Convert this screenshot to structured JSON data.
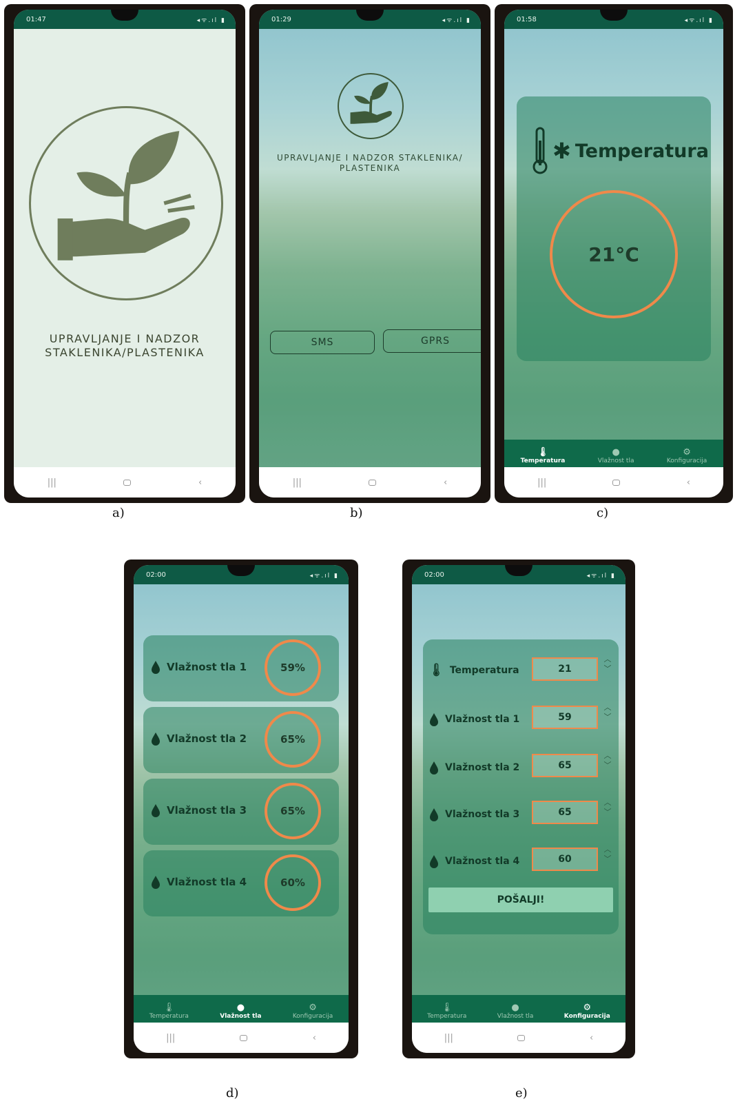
{
  "captions": [
    "a)",
    "b)",
    "c)",
    "d)",
    "e)"
  ],
  "status_times": {
    "a": "01:47",
    "b": "01:29",
    "c": "01:58",
    "d": "02:00",
    "e": "02:00"
  },
  "status_icons": "◂ᯤ.ıl ▮",
  "nav_buttons": {
    "recents": "|||",
    "back": "‹"
  },
  "app_title_a_line1": "UPRAVLJANJE I NADZOR",
  "app_title_a_line2": "STAKLENIKA/PLASTENIKA",
  "app_title_b_line1": "UPRAVLJANJE I NADZOR STAKLENIKA/",
  "app_title_b_line2": "PLASTENIKA",
  "connect_buttons": {
    "sms": "SMS",
    "gprs": "GPRS"
  },
  "temperature_screen": {
    "title": "Temperatura",
    "value": "21°C"
  },
  "moisture_screen": {
    "rows": [
      {
        "label": "Vlažnost tla 1",
        "value": "59%"
      },
      {
        "label": "Vlažnost tla 2",
        "value": "65%"
      },
      {
        "label": "Vlažnost tla 3",
        "value": "65%"
      },
      {
        "label": "Vlažnost tla 4",
        "value": "60%"
      }
    ]
  },
  "config_screen": {
    "rows": [
      {
        "label": "Temperatura",
        "value": "21"
      },
      {
        "label": "Vlažnost tla 1",
        "value": "59"
      },
      {
        "label": "Vlažnost tla 2",
        "value": "65"
      },
      {
        "label": "Vlažnost tla 3",
        "value": "65"
      },
      {
        "label": "Vlažnost tla 4",
        "value": "60"
      }
    ],
    "send_label": "POŠALJI!"
  },
  "tabs": {
    "temperature": "Temperatura",
    "moisture": "Vlažnost tla",
    "config": "Konfiguracija"
  },
  "colors": {
    "accent_orange": "#f0894a",
    "brand_green": "#0f6a4a",
    "logo_olive": "#6f7d5c"
  },
  "icons": [
    "thermometer-icon",
    "snowflake-icon",
    "drop-icon",
    "gear-icon",
    "plant-hand-icon"
  ]
}
